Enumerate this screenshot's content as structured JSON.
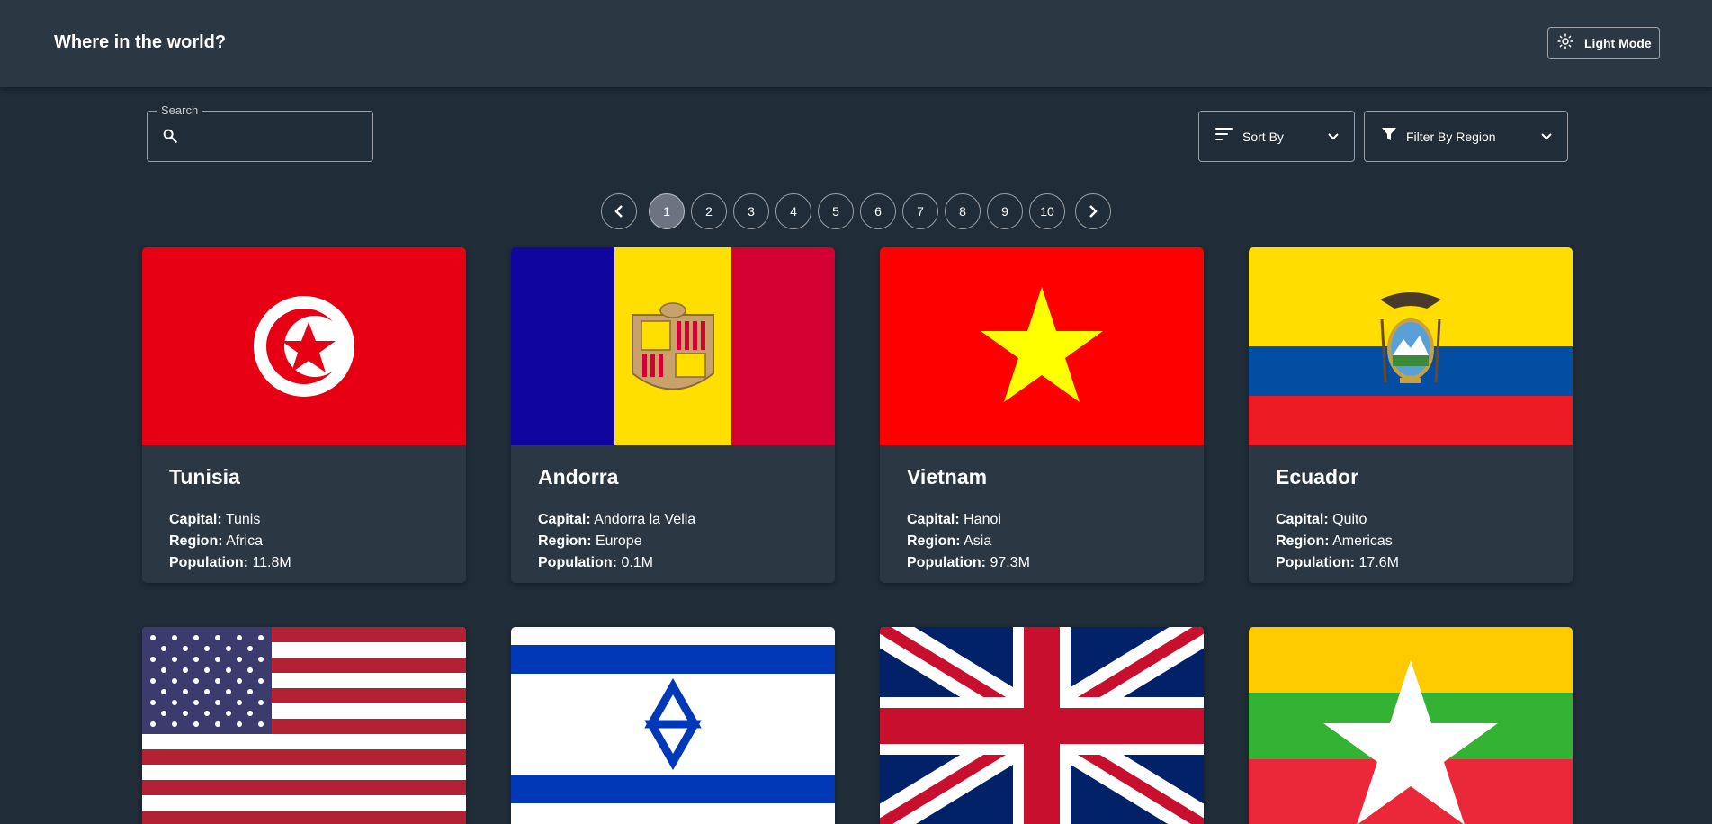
{
  "header": {
    "title": "Where in the world?",
    "mode_label": "Light Mode"
  },
  "search": {
    "label": "Search",
    "value": "",
    "placeholder": ""
  },
  "sort": {
    "label": "Sort By"
  },
  "filter": {
    "label": "Filter By Region"
  },
  "pagination": {
    "pages": [
      "1",
      "2",
      "3",
      "4",
      "5",
      "6",
      "7",
      "8",
      "9",
      "10"
    ],
    "current": "1"
  },
  "labels": {
    "capital": "Capital:",
    "region": "Region:",
    "population": "Population:"
  },
  "countries": [
    {
      "name": "Tunisia",
      "capital": "Tunis",
      "region": "Africa",
      "population": "11.8M",
      "flag": "tunisia-flag"
    },
    {
      "name": "Andorra",
      "capital": "Andorra la Vella",
      "region": "Europe",
      "population": "0.1M",
      "flag": "andorra-flag"
    },
    {
      "name": "Vietnam",
      "capital": "Hanoi",
      "region": "Asia",
      "population": "97.3M",
      "flag": "vietnam-flag"
    },
    {
      "name": "Ecuador",
      "capital": "Quito",
      "region": "Americas",
      "population": "17.6M",
      "flag": "ecuador-flag"
    }
  ],
  "partial_flags": [
    "united-states-flag",
    "israel-flag",
    "united-kingdom-flag",
    "myanmar-flag"
  ],
  "colors": {
    "background": "#202c37",
    "element": "#2b3743",
    "text": "#ffffff",
    "active_page": "#6b7480"
  }
}
